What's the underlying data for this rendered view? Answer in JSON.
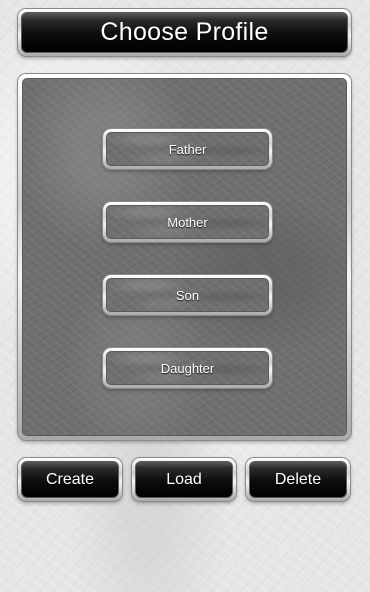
{
  "header": {
    "title": "Choose Profile"
  },
  "profiles": [
    {
      "label": "Father",
      "selected": true
    },
    {
      "label": "Mother",
      "selected": false
    },
    {
      "label": "Son",
      "selected": false
    },
    {
      "label": "Daughter",
      "selected": false
    }
  ],
  "actions": {
    "create_label": "Create",
    "load_label": "Load",
    "delete_label": "Delete"
  },
  "colors": {
    "selected_glow": "#00e0e8",
    "panel_background": "#6f6f6f",
    "button_face": "#000000",
    "button_text": "#ffffff"
  }
}
